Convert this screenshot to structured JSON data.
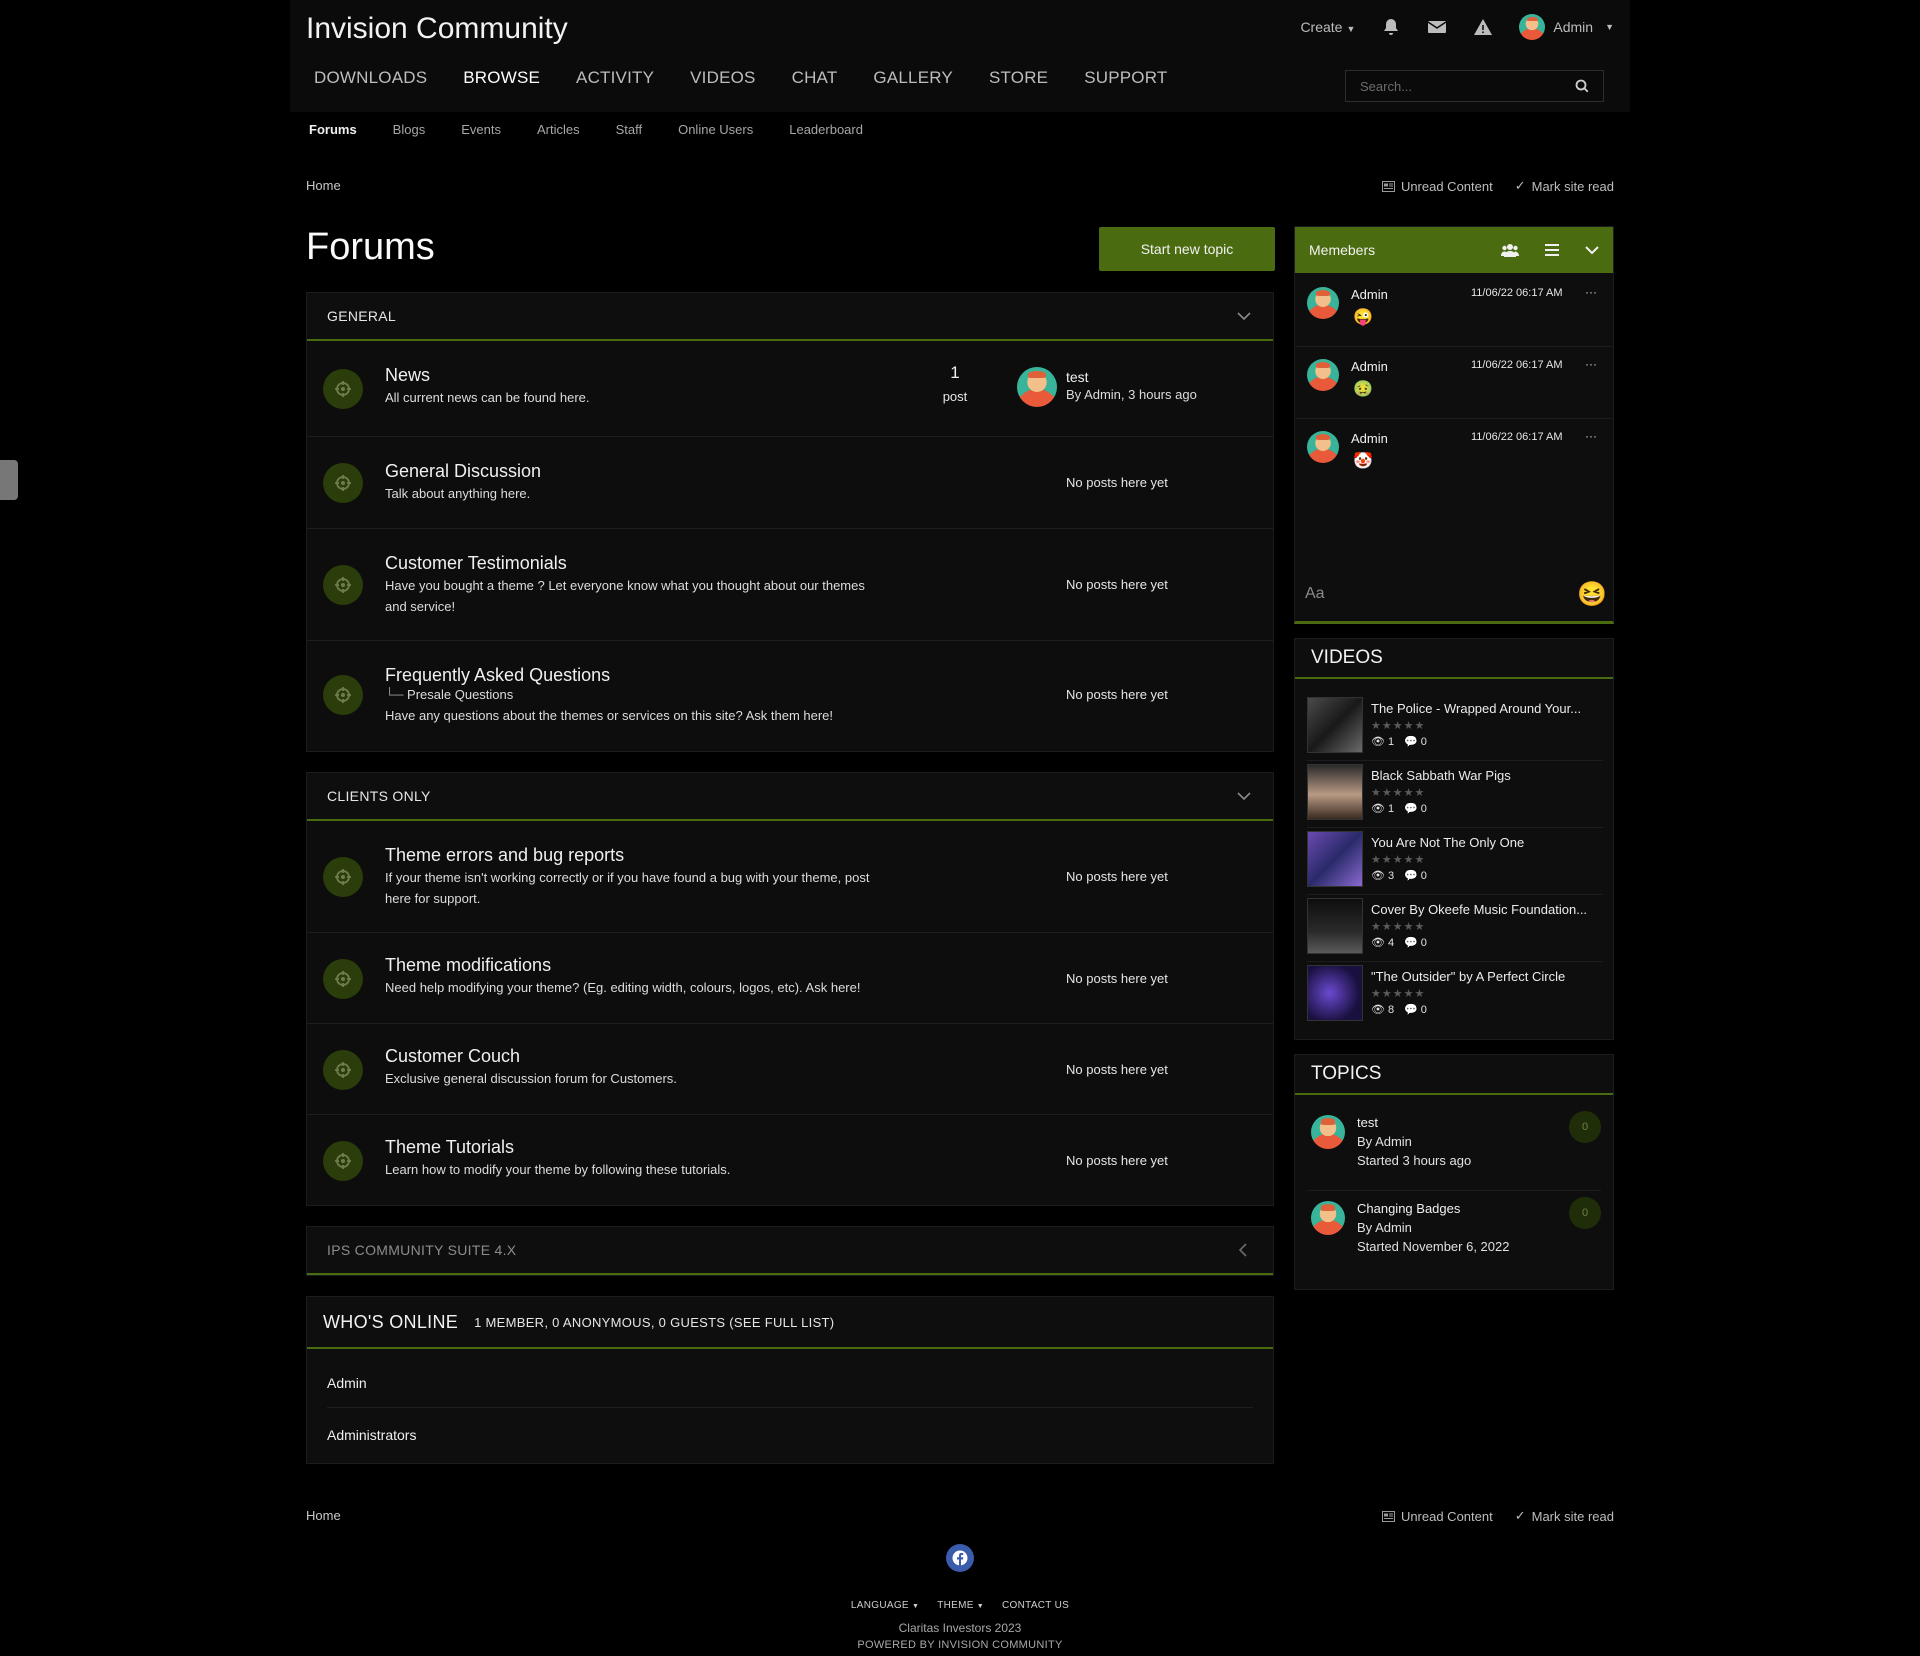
{
  "header": {
    "site_title": "Invision Community",
    "create_label": "Create",
    "user_name": "Admin",
    "nav": [
      "DOWNLOADS",
      "BROWSE",
      "ACTIVITY",
      "VIDEOS",
      "CHAT",
      "GALLERY",
      "STORE",
      "SUPPORT"
    ],
    "active_nav": "BROWSE",
    "search_placeholder": "Search..."
  },
  "subnav": [
    "Forums",
    "Blogs",
    "Events",
    "Articles",
    "Staff",
    "Online Users",
    "Leaderboard"
  ],
  "breadcrumb": {
    "home": "Home"
  },
  "toplinks": {
    "unread": "Unread Content",
    "mark_read": "Mark site read"
  },
  "page": {
    "title": "Forums",
    "new_topic": "Start new topic"
  },
  "categories": [
    {
      "title": "GENERAL",
      "forums": [
        {
          "name": "News",
          "desc": "All current news can be found here.",
          "count": "1",
          "count_label": "post",
          "last_title": "test",
          "last_by": "By Admin, 3 hours ago"
        },
        {
          "name": "General Discussion",
          "desc": "Talk about anything here.",
          "status": "No posts here yet"
        },
        {
          "name": "Customer Testimonials",
          "desc": "Have you bought a theme ? Let everyone know what you thought about our themes and service!",
          "status": "No posts here yet"
        },
        {
          "name": "Frequently Asked Questions",
          "sub": "Presale Questions",
          "desc": "Have any questions about the themes or services on this site? Ask them here!",
          "status": "No posts here yet"
        }
      ]
    },
    {
      "title": "CLIENTS ONLY",
      "forums": [
        {
          "name": "Theme errors and bug reports",
          "desc": "If your theme isn't working correctly or if you have found a bug with your theme, post here for support.",
          "status": "No posts here yet"
        },
        {
          "name": "Theme modifications",
          "desc": "Need help modifying your theme? (Eg. editing width, colours, logos, etc). Ask here!",
          "status": "No posts here yet"
        },
        {
          "name": "Customer Couch",
          "desc": "Exclusive general discussion forum for Customers.",
          "status": "No posts here yet"
        },
        {
          "name": "Theme Tutorials",
          "desc": "Learn how to modify your theme by following these tutorials.",
          "status": "No posts here yet"
        }
      ]
    },
    {
      "title": "IPS COMMUNITY SUITE 4.X"
    }
  ],
  "whos_online": {
    "title": "WHO'S ONLINE",
    "summary": "1 MEMBER, 0 ANONYMOUS, 0 GUESTS (SEE FULL LIST)",
    "member": "Admin",
    "group": "Administrators"
  },
  "chat": {
    "title": "Memebers",
    "messages": [
      {
        "user": "Admin",
        "time": "11/06/22 06:17 AM",
        "more": "···",
        "emoji": "😜"
      },
      {
        "user": "Admin",
        "time": "11/06/22 06:17 AM",
        "more": "···",
        "emoji": "🤢"
      },
      {
        "user": "Admin",
        "time": "11/06/22 06:17 AM",
        "more": "···",
        "emoji": "🤡"
      }
    ],
    "input_placeholder": "Aa",
    "emoji_button": "😆"
  },
  "videos": {
    "title": "VIDEOS",
    "items": [
      {
        "name": "The Police - Wrapped Around Your...",
        "views": "1",
        "comments": "0",
        "stars": "★★★★★",
        "rating": 0
      },
      {
        "name": "Black Sabbath War Pigs",
        "views": "1",
        "comments": "0",
        "stars": "★★★★★",
        "rating": 0
      },
      {
        "name": "You Are Not The Only One",
        "views": "3",
        "comments": "0",
        "stars": "★★★★★",
        "rating": 0
      },
      {
        "name": "Cover By Okeefe Music Foundation...",
        "views": "4",
        "comments": "0",
        "stars": "★★★★★",
        "rating": 0
      },
      {
        "name": "\"The Outsider\" by A Perfect Circle",
        "views": "8",
        "comments": "0",
        "stars": "★★★★★",
        "rating": 0
      }
    ]
  },
  "topics": {
    "title": "TOPICS",
    "items": [
      {
        "title": "test",
        "by": "By Admin",
        "started": "Started 3 hours ago",
        "replies": "0"
      },
      {
        "title": "Changing Badges",
        "by": "By Admin",
        "started": "Started November 6, 2022",
        "replies": "0"
      }
    ]
  },
  "footer": {
    "home": "Home",
    "language": "LANGUAGE",
    "theme": "THEME",
    "contact": "CONTACT US",
    "copyright": "Claritas Investors 2023",
    "powered": "POWERED BY INVISION COMMUNITY"
  },
  "colors": {
    "accent": "#4a6b10",
    "background": "#000000",
    "panel": "#0e0e0e"
  }
}
